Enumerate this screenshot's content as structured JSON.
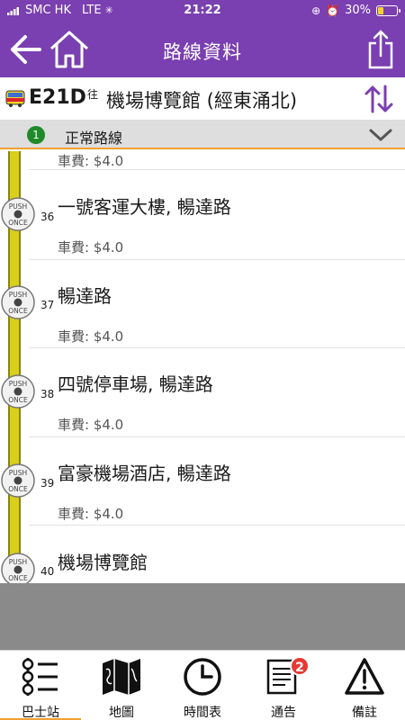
{
  "status_bar": {
    "carrier": "SMC HK",
    "network": "LTE",
    "time": "21:22",
    "battery": "30%",
    "battery_level": 0.3
  },
  "nav": {
    "title": "路線資料"
  },
  "route": {
    "number": "E21D",
    "towards": "往",
    "destination": "機場博覽館 (經東涌北)"
  },
  "variant": {
    "index": "1",
    "label": "正常路線"
  },
  "stops": [
    {
      "seq": "",
      "name": "",
      "fare": "車費: $4.0"
    },
    {
      "seq": "36",
      "name": "一號客運大樓, 暢達路",
      "fare": "車費: $4.0"
    },
    {
      "seq": "37",
      "name": "暢達路",
      "fare": "車費: $4.0"
    },
    {
      "seq": "38",
      "name": "四號停車場, 暢達路",
      "fare": "車費: $4.0"
    },
    {
      "seq": "39",
      "name": "富豪機場酒店, 暢達路",
      "fare": "車費: $4.0"
    },
    {
      "seq": "40",
      "name": "機場博覽館",
      "fare": ""
    }
  ],
  "push_button": {
    "label_top": "PUSH",
    "label_bottom": "ONCE"
  },
  "tabs": [
    {
      "label": "巴士站",
      "icon": "bus-stop-list-icon",
      "active": true
    },
    {
      "label": "地圖",
      "icon": "map-icon",
      "active": false
    },
    {
      "label": "時間表",
      "icon": "clock-icon",
      "active": false
    },
    {
      "label": "通告",
      "icon": "notice-icon",
      "active": false,
      "badge": "2"
    },
    {
      "label": "備註",
      "icon": "warning-icon",
      "active": false
    }
  ],
  "colors": {
    "header": "#7a3fb0",
    "route_line": "#d8d01c",
    "accent": "#f0a030",
    "variant_badge": "#1e8a2a",
    "badge": "#e53935"
  }
}
